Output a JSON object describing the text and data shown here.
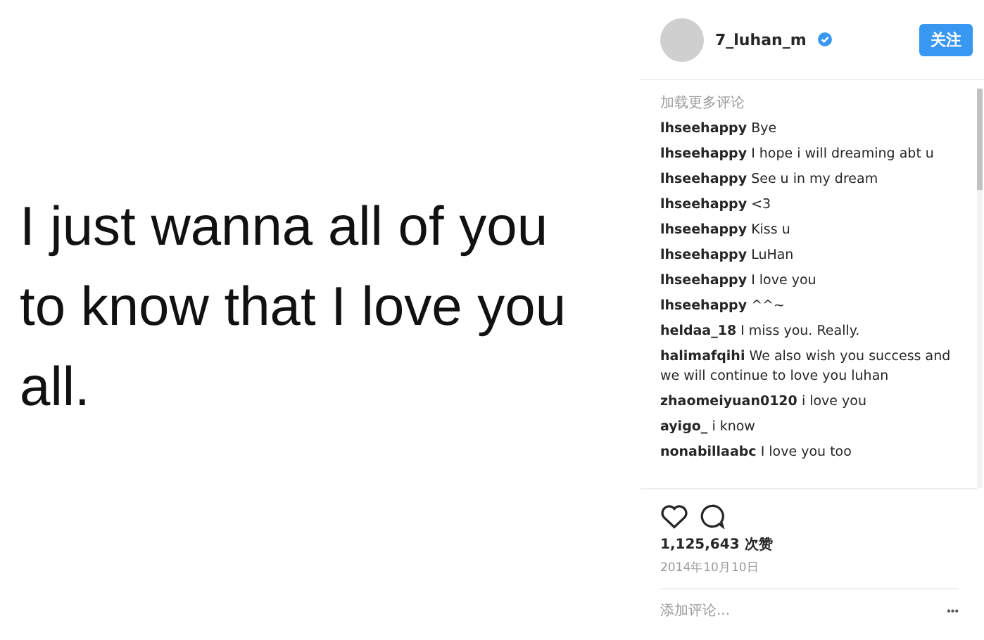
{
  "post": {
    "image_text": "I just wanna all of you to know that I love you all."
  },
  "header": {
    "username": "7_luhan_m",
    "verified": true,
    "follow_button": "关注"
  },
  "load_more": "加载更多评论",
  "comments": [
    {
      "user": "lhseehappy",
      "text": "Bye"
    },
    {
      "user": "lhseehappy",
      "text": "I hope i will dreaming abt u"
    },
    {
      "user": "lhseehappy",
      "text": "See u in my dream"
    },
    {
      "user": "lhseehappy",
      "text": "<3"
    },
    {
      "user": "lhseehappy",
      "text": "Kiss u"
    },
    {
      "user": "lhseehappy",
      "text": "LuHan"
    },
    {
      "user": "lhseehappy",
      "text": "I love you"
    },
    {
      "user": "lhseehappy",
      "text": "^^~"
    },
    {
      "user": "heldaa_18",
      "text": "I miss you. Really."
    },
    {
      "user": "halimafqihi",
      "text": "We also wish you success and we will continue to love you luhan"
    },
    {
      "user": "zhaomeiyuan0120",
      "text": "i love you"
    },
    {
      "user": "ayigo_",
      "text": "i know"
    },
    {
      "user": "nonabillaabc",
      "text": "I love you too"
    }
  ],
  "likes": "1,125,643 次赞",
  "date": "2014年10月10日",
  "add_comment": {
    "placeholder": "添加评论..."
  },
  "more_button": "•••"
}
